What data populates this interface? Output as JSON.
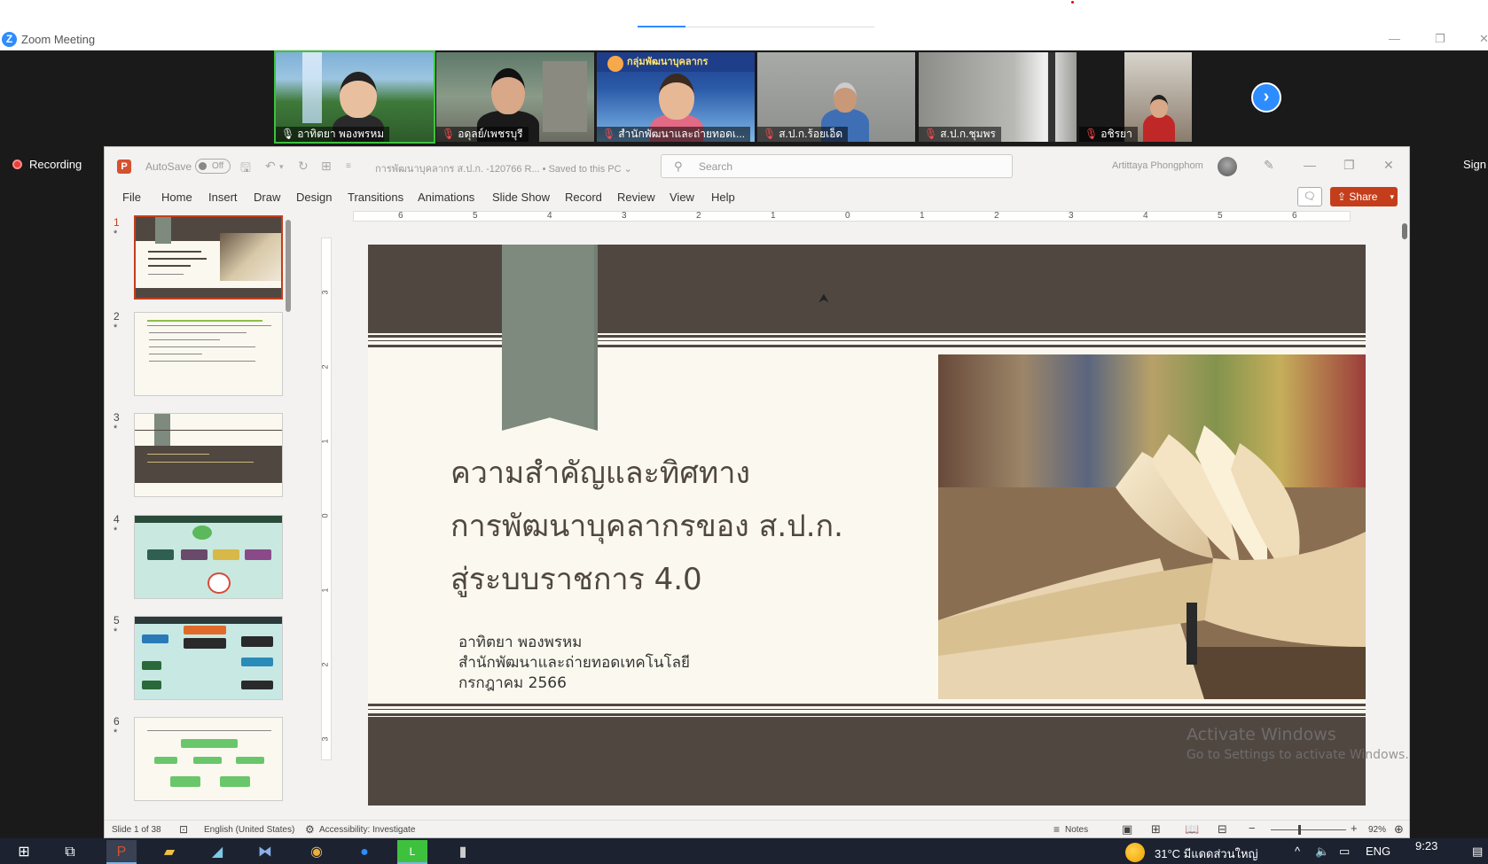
{
  "zoom": {
    "app_title": "Zoom Meeting",
    "recording_label": "Recording",
    "sign_label": "Sign",
    "participants": [
      {
        "name": "อาทิตยา พองพรหม",
        "muted": false
      },
      {
        "name": "อดุลย์/เพชรบุรี",
        "muted": true
      },
      {
        "name": "สำนักพัฒนาและถ่ายทอดเ...",
        "muted": true,
        "banner": "กลุ่มพัฒนาบุคลากร"
      },
      {
        "name": "ส.ป.ก.ร้อยเอ็ด",
        "muted": true
      },
      {
        "name": "ส.ป.ก.ชุมพร",
        "muted": true
      },
      {
        "name": "อชิรยา",
        "muted": true
      }
    ],
    "next_icon": "chevron-right-icon"
  },
  "ppt": {
    "autosave_label": "AutoSave",
    "autosave_state": "Off",
    "doc_title": "การพัฒนาบุคลากร ส.ป.ก. -120766 R... • Saved to this PC ⌄",
    "search_placeholder": "Search",
    "user_name": "Artittaya Phongphom",
    "ribbon_tabs": [
      "File",
      "Home",
      "Insert",
      "Draw",
      "Design",
      "Transitions",
      "Animations",
      "Slide Show",
      "Record",
      "Review",
      "View",
      "Help"
    ],
    "share_label": "Share",
    "thumbnails": [
      {
        "num": "1",
        "star": "*",
        "selected": true
      },
      {
        "num": "2",
        "star": "*",
        "selected": false
      },
      {
        "num": "3",
        "star": "*",
        "selected": false
      },
      {
        "num": "4",
        "star": "*",
        "selected": false
      },
      {
        "num": "5",
        "star": "*",
        "selected": false
      },
      {
        "num": "6",
        "star": "*",
        "selected": false
      }
    ],
    "ruler_h": [
      "6",
      "5",
      "4",
      "3",
      "2",
      "1",
      "0",
      "1",
      "2",
      "3",
      "4",
      "5",
      "6"
    ],
    "ruler_v": [
      "3",
      "2",
      "1",
      "0",
      "1",
      "2",
      "3"
    ],
    "slide": {
      "title_lines": [
        "ความสำคัญและทิศทาง",
        "การพัฒนาบุคลากรของ ส.ป.ก.",
        "สู่ระบบราชการ 4.0"
      ],
      "subtitle_lines": [
        "อาทิตยา  พองพรหม",
        "สำนักพัฒนาและถ่ายทอดเทคโนโลยี",
        "กรกฎาคม 2566"
      ],
      "colors": {
        "band": "#514741",
        "bookmark": "#7d8a7d",
        "background": "#fbf9ef"
      }
    },
    "watermark": {
      "line1": "Activate Windows",
      "line2": "Go to Settings to activate Windows."
    },
    "status": {
      "slide_count": "Slide 1 of 38",
      "language": "English (United States)",
      "accessibility": "Accessibility: Investigate",
      "notes": "Notes",
      "zoom": "92%"
    }
  },
  "taskbar": {
    "weather": "31°C  มีแดดส่วนใหญ่",
    "language": "ENG",
    "time": "9:23"
  }
}
